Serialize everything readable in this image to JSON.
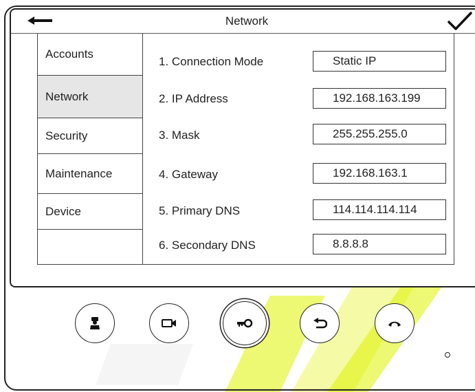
{
  "header": {
    "title": "Network",
    "back_icon": "arrow-left-icon",
    "confirm_icon": "checkmark-icon"
  },
  "sidebar": {
    "items": [
      {
        "label": "Accounts"
      },
      {
        "label": "Network",
        "active": true
      },
      {
        "label": "Security"
      },
      {
        "label": "Maintenance"
      },
      {
        "label": "Device"
      },
      {
        "label": ""
      }
    ]
  },
  "settings": [
    {
      "label": "1. Connection Mode",
      "value": "Static IP"
    },
    {
      "label": "2. IP Address",
      "value": "192.168.163.199"
    },
    {
      "label": "3. Mask",
      "value": "255.255.255.0"
    },
    {
      "label": "4. Gateway",
      "value": "192.168.163.1"
    },
    {
      "label": "5. Primary DNS",
      "value": "114.114.114.114"
    },
    {
      "label": "6. Secondary DNS",
      "value": "8.8.8.8"
    }
  ],
  "hardware_buttons": [
    {
      "icon": "concierge-icon"
    },
    {
      "icon": "camera-icon"
    },
    {
      "icon": "key-icon"
    },
    {
      "icon": "return-icon"
    },
    {
      "icon": "hangup-icon"
    }
  ],
  "colors": {
    "active_tab": "#e6e6e6",
    "border": "#222222",
    "watermark": "#dff200"
  }
}
